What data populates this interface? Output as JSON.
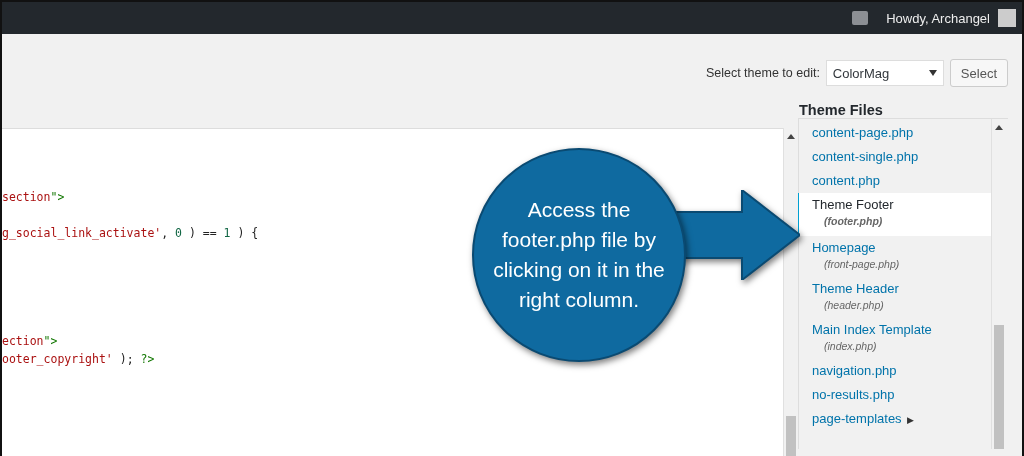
{
  "admin_bar": {
    "greeting": "Howdy, Archangel"
  },
  "theme_select": {
    "label": "Select theme to edit:",
    "value": "ColorMag",
    "button": "Select"
  },
  "editor": {
    "lines": [
      {
        "kind": "blank"
      },
      {
        "kind": "blank"
      },
      {
        "kind": "blank"
      },
      {
        "kind": "code",
        "tokens": [
          {
            "text": "section",
            "kind": "string"
          },
          {
            "text": "\">",
            "kind": "tag"
          }
        ]
      },
      {
        "kind": "blank"
      },
      {
        "kind": "code",
        "tokens": [
          {
            "text": "g_social_link_activate'",
            "kind": "string"
          },
          {
            "text": ", ",
            "kind": "plain"
          },
          {
            "text": "0",
            "kind": "number"
          },
          {
            "text": " ) == ",
            "kind": "plain"
          },
          {
            "text": "1",
            "kind": "number"
          },
          {
            "text": " ) {",
            "kind": "plain"
          }
        ]
      },
      {
        "kind": "blank"
      },
      {
        "kind": "blank"
      },
      {
        "kind": "blank"
      },
      {
        "kind": "blank"
      },
      {
        "kind": "blank"
      },
      {
        "kind": "code",
        "tokens": [
          {
            "text": "ection",
            "kind": "string"
          },
          {
            "text": "\">",
            "kind": "tag"
          }
        ]
      },
      {
        "kind": "code",
        "tokens": [
          {
            "text": "ooter_copyright'",
            "kind": "string"
          },
          {
            "text": " ); ",
            "kind": "plain"
          },
          {
            "text": "?>",
            "kind": "tag"
          }
        ]
      }
    ]
  },
  "theme_files": {
    "title": "Theme Files",
    "items": [
      {
        "kind": "file",
        "name": "content-page.php",
        "selected": false
      },
      {
        "kind": "file",
        "name": "content-single.php",
        "selected": false
      },
      {
        "kind": "file",
        "name": "content.php",
        "selected": false
      },
      {
        "kind": "file",
        "name": "Theme Footer",
        "file": "(footer.php)",
        "selected": true
      },
      {
        "kind": "file",
        "name": "Homepage",
        "file": "(front-page.php)",
        "selected": false
      },
      {
        "kind": "file",
        "name": "Theme Header",
        "file": "(header.php)",
        "selected": false
      },
      {
        "kind": "file",
        "name": "Main Index Template",
        "file": "(index.php)",
        "selected": false
      },
      {
        "kind": "file",
        "name": "navigation.php",
        "selected": false
      },
      {
        "kind": "file",
        "name": "no-results.php",
        "selected": false
      },
      {
        "kind": "folder",
        "name": "page-templates",
        "toggle": "▶",
        "selected": false
      }
    ]
  },
  "callout": {
    "text": "Access the footer.php file by clicking on it in the right column."
  }
}
